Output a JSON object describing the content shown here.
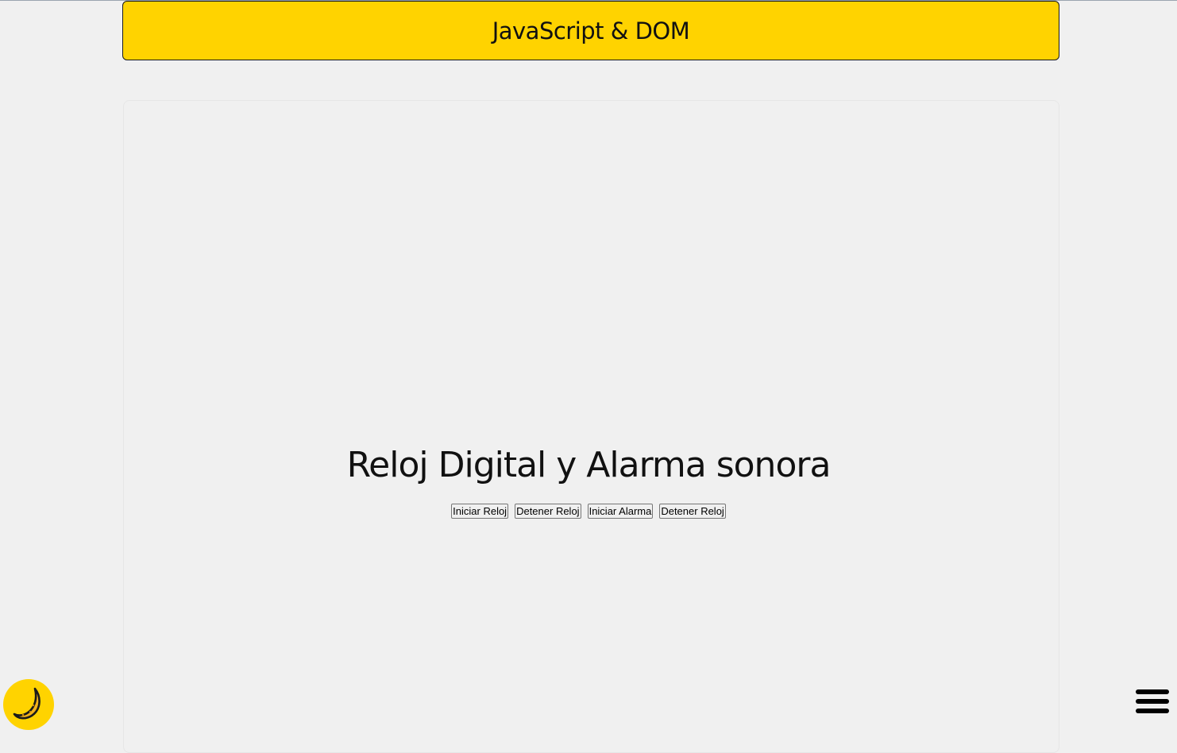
{
  "header": {
    "title": "JavaScript & DOM"
  },
  "main": {
    "section_title": "Reloj Digital y Alarma sonora",
    "buttons": [
      {
        "label": "Iniciar Reloj"
      },
      {
        "label": "Detener Reloj"
      },
      {
        "label": "Iniciar Alarma"
      },
      {
        "label": "Detener Reloj"
      }
    ]
  },
  "controls": {
    "theme_toggle_icon": "moon-icon",
    "menu_icon": "hamburger-menu-icon",
    "accent_color": "#ffd300"
  }
}
